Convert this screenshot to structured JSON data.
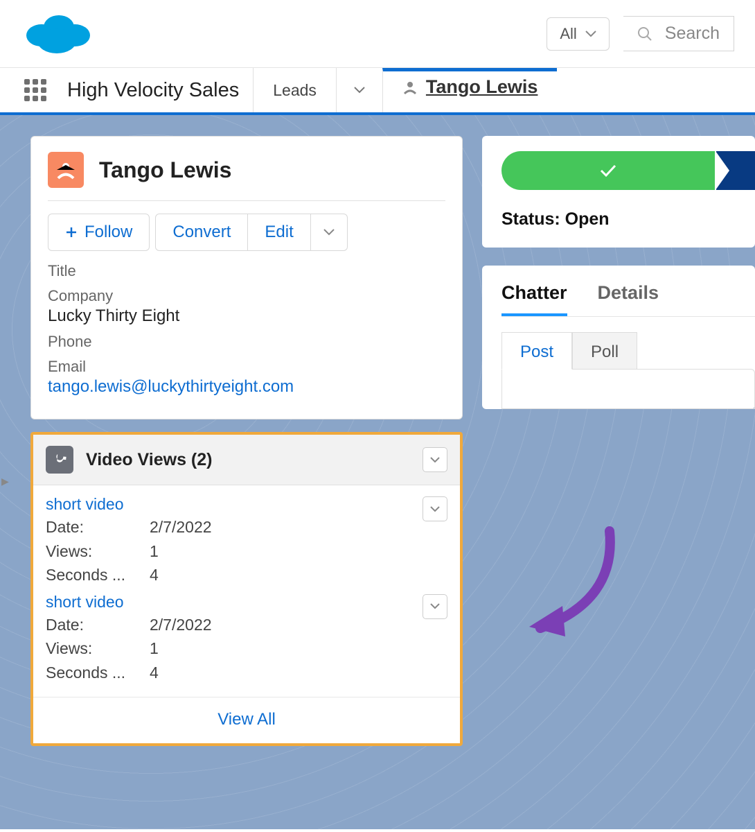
{
  "header": {
    "scope_label": "All",
    "search_placeholder": "Search"
  },
  "nav": {
    "app_name": "High Velocity Sales",
    "object_tab": "Leads",
    "record_tab": "Tango Lewis"
  },
  "lead": {
    "name": "Tango Lewis",
    "buttons": {
      "follow": "Follow",
      "convert": "Convert",
      "edit": "Edit"
    },
    "fields": {
      "title_label": "Title",
      "title_value": "",
      "company_label": "Company",
      "company_value": "Lucky Thirty Eight",
      "phone_label": "Phone",
      "phone_value": "",
      "email_label": "Email",
      "email_value": "tango.lewis@luckythirtyeight.com"
    }
  },
  "related": {
    "title": "Video Views (2)",
    "view_all": "View All",
    "items": [
      {
        "title": "short video",
        "date_label": "Date:",
        "date_value": "2/7/2022",
        "views_label": "Views:",
        "views_value": "1",
        "seconds_label": "Seconds ...",
        "seconds_value": "4"
      },
      {
        "title": "short video",
        "date_label": "Date:",
        "date_value": "2/7/2022",
        "views_label": "Views:",
        "views_value": "1",
        "seconds_label": "Seconds ...",
        "seconds_value": "4"
      }
    ]
  },
  "status": {
    "label": "Status: Open"
  },
  "chatter": {
    "tab_chatter": "Chatter",
    "tab_details": "Details",
    "subtab_post": "Post",
    "subtab_poll": "Poll"
  }
}
